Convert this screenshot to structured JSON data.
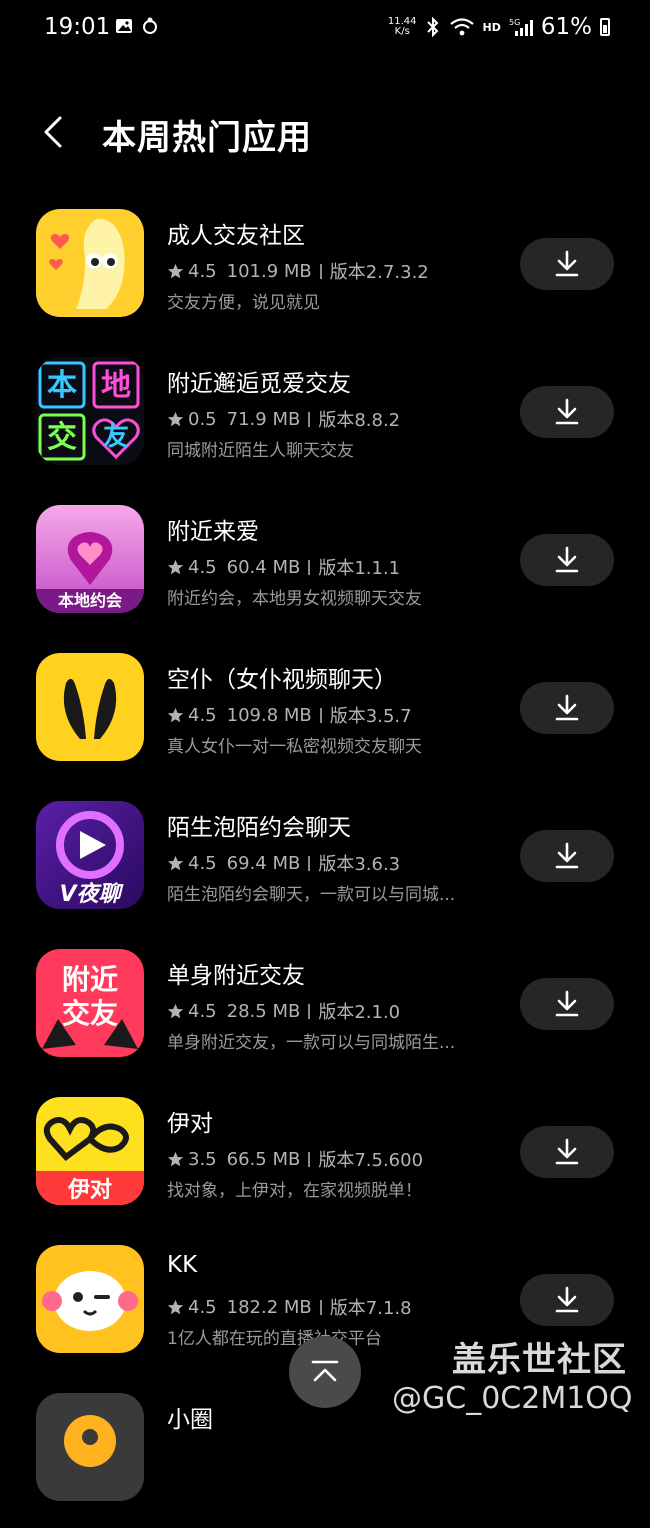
{
  "status_bar": {
    "time": "19:01",
    "net_speed_value": "11.44",
    "net_speed_unit": "K/s",
    "hd": "HD",
    "network": "5G",
    "battery": "61%"
  },
  "header": {
    "title": "本周热门应用"
  },
  "apps": [
    {
      "name": "成人交友社区",
      "rating": "4.5",
      "size": "101.9 MB",
      "version": "版本2.7.3.2",
      "desc": "交友方便，说见就见",
      "icon": "banana-icon"
    },
    {
      "name": "附近邂逅觅爱交友",
      "rating": "0.5",
      "size": "71.9 MB",
      "version": "版本8.8.2",
      "desc": "同城附近陌生人聊天交友",
      "icon": "neon-grid-icon",
      "icon_text": [
        "本",
        "地",
        "交",
        "友"
      ]
    },
    {
      "name": "附近来爱",
      "rating": "4.5",
      "size": "60.4 MB",
      "version": "版本1.1.1",
      "desc": "附近约会，本地男女视频聊天交友",
      "icon": "heart-pin-icon",
      "icon_text": [
        "本地约会"
      ]
    },
    {
      "name": "空仆（女仆视频聊天）",
      "rating": "4.5",
      "size": "109.8 MB",
      "version": "版本3.5.7",
      "desc": "真人女仆一对一私密视频交友聊天",
      "icon": "bunny-ears-icon"
    },
    {
      "name": "陌生泡陌约会聊天",
      "rating": "4.5",
      "size": "69.4 MB",
      "version": "版本3.6.3",
      "desc": "陌生泡陌约会聊天，一款可以与同城...",
      "icon": "play-badge-icon",
      "icon_text": [
        "V夜聊"
      ]
    },
    {
      "name": "单身附近交友",
      "rating": "4.5",
      "size": "28.5 MB",
      "version": "版本2.1.0",
      "desc": "单身附近交友，一款可以与同城陌生...",
      "icon": "high-heels-icon",
      "icon_text": [
        "附近",
        "交友"
      ]
    },
    {
      "name": "伊对",
      "rating": "3.5",
      "size": "66.5 MB",
      "version": "版本7.5.600",
      "desc": "找对象，上伊对，在家视频脱单！",
      "icon": "heart-infinity-icon",
      "icon_text": [
        "伊对"
      ]
    },
    {
      "name": "KK",
      "rating": "4.5",
      "size": "182.2 MB",
      "version": "版本7.1.8",
      "desc": "1亿人都在玩的直播社交平台",
      "icon": "cloud-face-icon"
    },
    {
      "name": "小圈",
      "rating": "",
      "size": "",
      "version": "",
      "desc": "",
      "icon": "pin-circle-icon"
    }
  ],
  "colors": {
    "background": "#000000",
    "download_button": "#262626",
    "meta_text": "#b3b3b3"
  },
  "watermark": {
    "line1": "盖乐世社区",
    "line2": "@GC_0C2M1OQ"
  }
}
